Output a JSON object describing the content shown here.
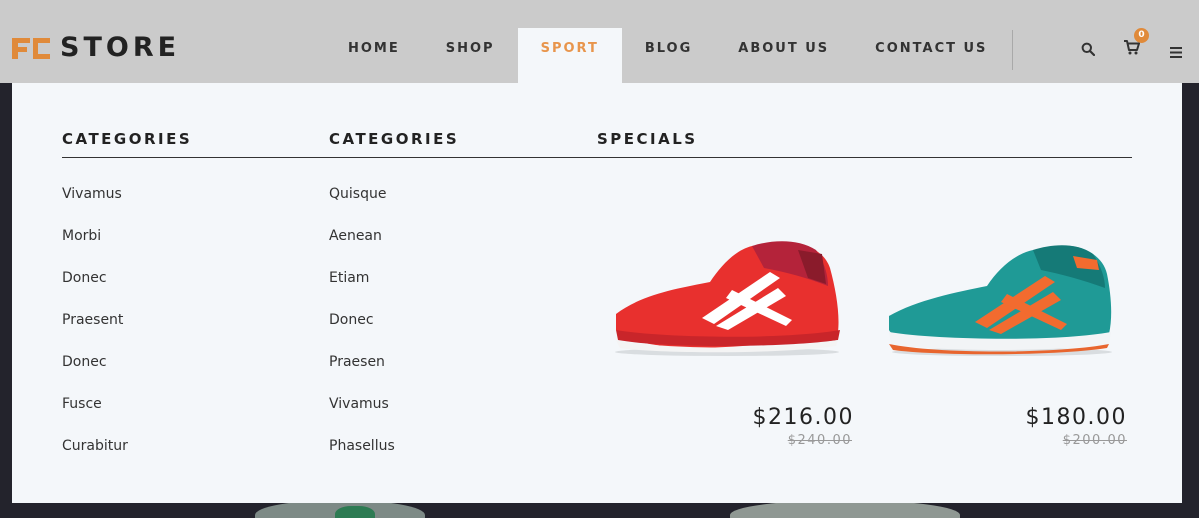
{
  "brand": {
    "name": "STORE",
    "accent": "#e08a3a"
  },
  "nav": {
    "items": [
      "HOME",
      "SHOP",
      "SPORT",
      "BLOG",
      "ABOUT US",
      "CONTACT US"
    ],
    "active": "SPORT",
    "active_color": "#e8954c"
  },
  "header_icons": {
    "search": "search-icon",
    "cart": "cart-icon",
    "cart_count": "0",
    "menu": "hamburger-menu-icon"
  },
  "mega_menu": {
    "columns": [
      {
        "title": "CATEGORIES",
        "links": [
          "Vivamus",
          "Morbi",
          "Donec",
          "Praesent",
          "Donec",
          "Fusce",
          "Curabitur"
        ]
      },
      {
        "title": "CATEGORIES",
        "links": [
          "Quisque",
          "Aenean",
          "Etiam",
          "Donec",
          "Praesen",
          "Vivamus",
          "Phasellus"
        ]
      }
    ],
    "specials": {
      "title": "SPECIALS",
      "products": [
        {
          "image": "red-running-shoe",
          "price": "$216.00",
          "old_price": "$240.00",
          "color": "#e8302e"
        },
        {
          "image": "teal-running-shoe",
          "price": "$180.00",
          "old_price": "$200.00",
          "color": "#1f9a96"
        }
      ]
    }
  }
}
